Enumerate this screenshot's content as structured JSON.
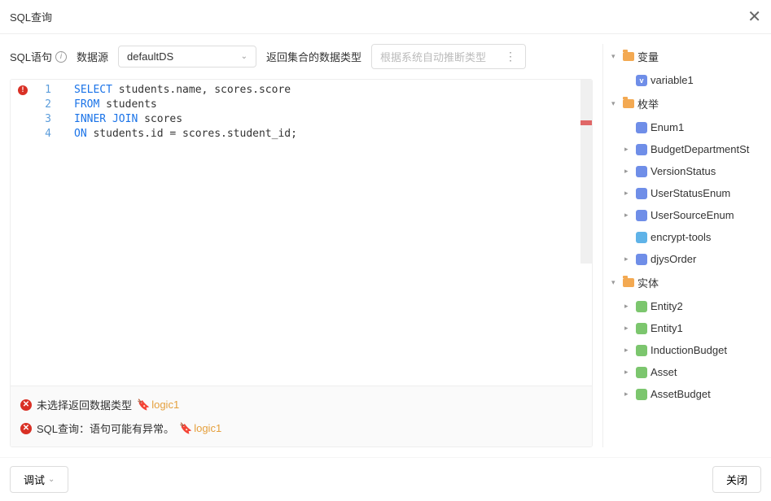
{
  "header": {
    "title": "SQL查询"
  },
  "toolbar": {
    "sql_label": "SQL语句",
    "ds_label": "数据源",
    "ds_value": "defaultDS",
    "return_label": "返回集合的数据类型",
    "return_placeholder": "根据系统自动推断类型"
  },
  "code": {
    "lines": [
      {
        "n": "1",
        "tokens": [
          [
            "kw",
            "SELECT"
          ],
          [
            "tok",
            " students.name, scores.score"
          ]
        ]
      },
      {
        "n": "2",
        "tokens": [
          [
            "kw",
            "FROM"
          ],
          [
            "tok",
            " students"
          ]
        ]
      },
      {
        "n": "3",
        "tokens": [
          [
            "kw",
            "INNER JOIN"
          ],
          [
            "tok",
            " scores"
          ]
        ]
      },
      {
        "n": "4",
        "tokens": [
          [
            "kw",
            "ON"
          ],
          [
            "tok",
            " students.id = scores.student_id;"
          ]
        ]
      }
    ]
  },
  "errors": [
    {
      "text": "未选择返回数据类型",
      "tag": "logic1"
    },
    {
      "text": "SQL查询：语句可能有异常。",
      "tag": "logic1"
    }
  ],
  "tree": [
    {
      "type": "folder",
      "label": "变量",
      "toggle": "▾",
      "level": 0
    },
    {
      "type": "item",
      "label": "variable1",
      "icon": "icon-var",
      "glyph": "v",
      "level": 1
    },
    {
      "type": "folder",
      "label": "枚举",
      "toggle": "▾",
      "level": 0
    },
    {
      "type": "item",
      "label": "Enum1",
      "icon": "icon-enum",
      "glyph": "",
      "toggle": "",
      "level": 1
    },
    {
      "type": "item",
      "label": "BudgetDepartmentSt",
      "icon": "icon-enum",
      "glyph": "",
      "toggle": "▸",
      "level": 1
    },
    {
      "type": "item",
      "label": "VersionStatus",
      "icon": "icon-enum",
      "glyph": "",
      "toggle": "▸",
      "level": 1
    },
    {
      "type": "item",
      "label": "UserStatusEnum",
      "icon": "icon-enum",
      "glyph": "",
      "toggle": "▸",
      "level": 1
    },
    {
      "type": "item",
      "label": "UserSourceEnum",
      "icon": "icon-enum",
      "glyph": "",
      "toggle": "▸",
      "level": 1
    },
    {
      "type": "item",
      "label": "encrypt-tools",
      "icon": "icon-tool",
      "glyph": "",
      "toggle": "",
      "level": 1
    },
    {
      "type": "item",
      "label": "djysOrder",
      "icon": "icon-enum",
      "glyph": "",
      "toggle": "▸",
      "level": 1
    },
    {
      "type": "folder",
      "label": "实体",
      "toggle": "▾",
      "level": 0
    },
    {
      "type": "item",
      "label": "Entity2",
      "icon": "icon-entity",
      "glyph": "",
      "toggle": "▸",
      "level": 1
    },
    {
      "type": "item",
      "label": "Entity1",
      "icon": "icon-entity",
      "glyph": "",
      "toggle": "▸",
      "level": 1
    },
    {
      "type": "item",
      "label": "InductionBudget",
      "icon": "icon-entity",
      "glyph": "",
      "toggle": "▸",
      "level": 1
    },
    {
      "type": "item",
      "label": "Asset",
      "icon": "icon-entity",
      "glyph": "",
      "toggle": "▸",
      "level": 1
    },
    {
      "type": "item",
      "label": "AssetBudget",
      "icon": "icon-entity",
      "glyph": "",
      "toggle": "▸",
      "level": 1
    }
  ],
  "footer": {
    "debug": "调试",
    "close": "关闭"
  }
}
